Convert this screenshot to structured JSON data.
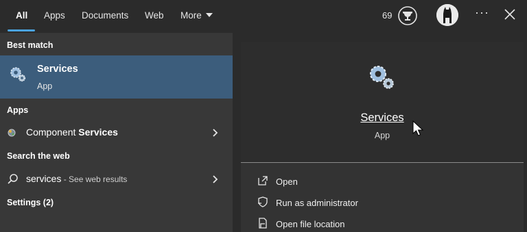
{
  "tabs": [
    {
      "label": "All",
      "active": true
    },
    {
      "label": "Apps"
    },
    {
      "label": "Documents"
    },
    {
      "label": "Web"
    },
    {
      "label": "More"
    }
  ],
  "header": {
    "points": "69",
    "more_options": "···"
  },
  "colors": {
    "accent": "#4aa3df",
    "selection": "#3c5d7c"
  },
  "sections": {
    "best_match": "Best match",
    "apps": "Apps",
    "search_web": "Search the web",
    "settings": "Settings (2)"
  },
  "best_match": {
    "title": "Services",
    "subtitle": "App",
    "icon": "gears-icon"
  },
  "apps": [
    {
      "prefix": "Component ",
      "bold": "Services",
      "icon": "component-services-icon"
    }
  ],
  "web": {
    "query": "services",
    "suffix": " - See web results",
    "icon": "search-icon"
  },
  "details": {
    "title": "Services",
    "subtitle": "App"
  },
  "actions": [
    {
      "label": "Open",
      "icon": "open-icon"
    },
    {
      "label": "Run as administrator",
      "icon": "shield-icon"
    },
    {
      "label": "Open file location",
      "icon": "folder-location-icon"
    }
  ]
}
